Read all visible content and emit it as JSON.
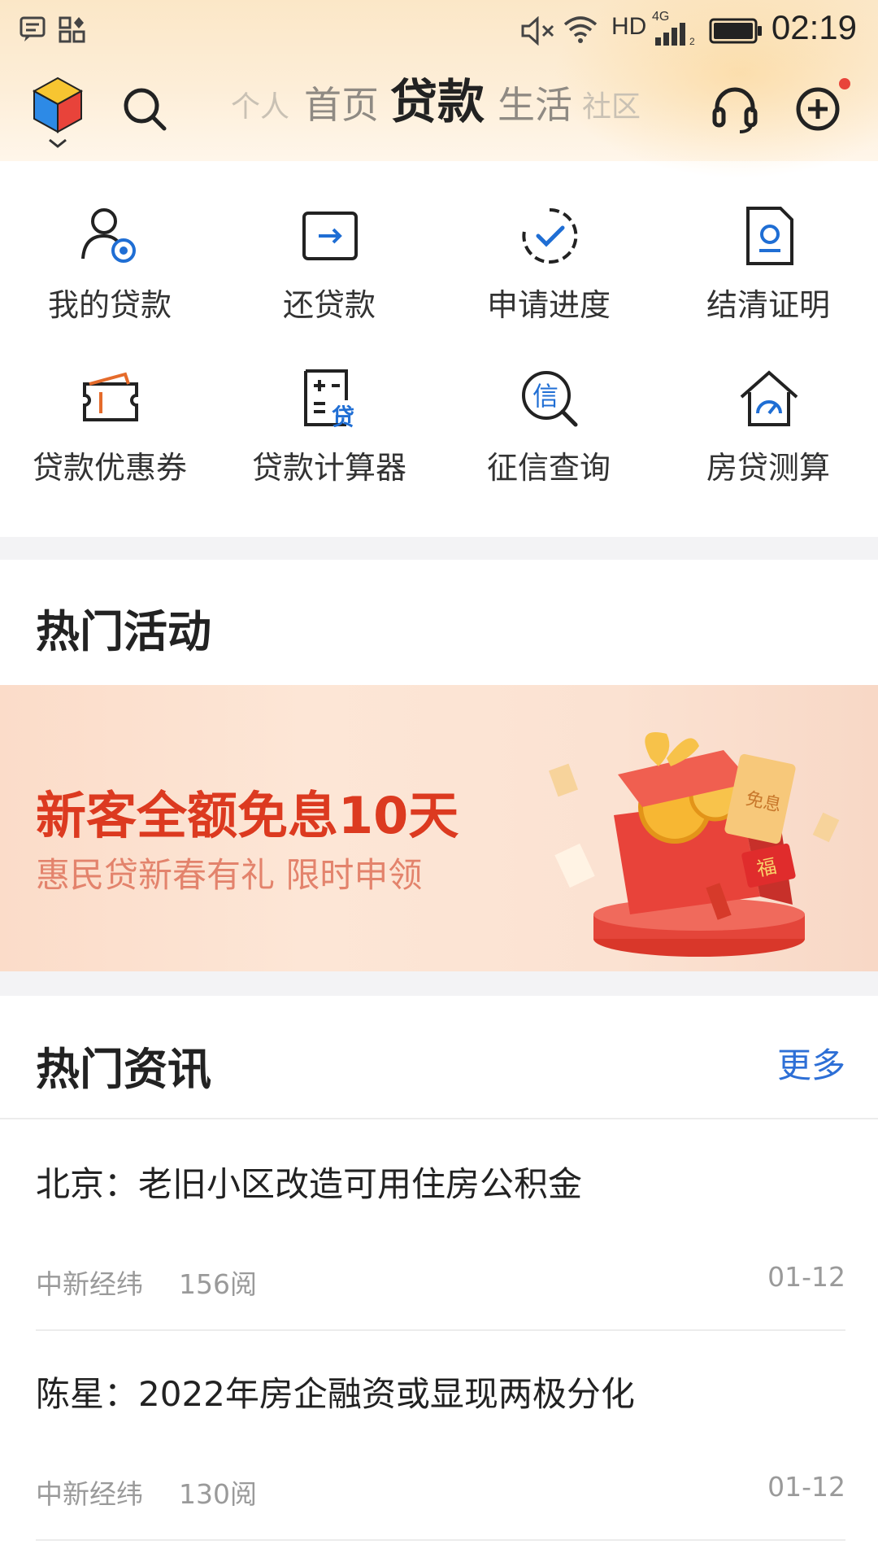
{
  "status_bar": {
    "network": "HD",
    "signal_label": "4G",
    "time": "02:19",
    "icons": [
      "message-icon",
      "apps-icon",
      "mute-icon",
      "wifi-icon",
      "signal-icon",
      "battery-icon"
    ]
  },
  "top_nav": {
    "tabs": [
      {
        "label": "个人",
        "active": false
      },
      {
        "label": "首页",
        "active": false
      },
      {
        "label": "贷款",
        "active": true
      },
      {
        "label": "生活",
        "active": false
      },
      {
        "label": "社区",
        "active": false
      }
    ],
    "right_icons": [
      "headset-icon",
      "add-icon"
    ]
  },
  "services": [
    {
      "label": "我的贷款",
      "icon": "user-loan-icon"
    },
    {
      "label": "还贷款",
      "icon": "repay-icon"
    },
    {
      "label": "申请进度",
      "icon": "progress-check-icon"
    },
    {
      "label": "结清证明",
      "icon": "certificate-icon"
    },
    {
      "label": "贷款优惠券",
      "icon": "coupon-icon"
    },
    {
      "label": "贷款计算器",
      "icon": "calculator-icon"
    },
    {
      "label": "征信查询",
      "icon": "credit-search-icon"
    },
    {
      "label": "房贷测算",
      "icon": "house-gauge-icon"
    }
  ],
  "activities": {
    "title": "热门活动",
    "banner": {
      "headline": "新客全额免息10天",
      "subline": "惠民贷新春有礼 限时申领",
      "gift_text_1": "免息",
      "gift_text_2": "福"
    }
  },
  "news": {
    "title": "热门资讯",
    "more_label": "更多",
    "items": [
      {
        "title": "北京：老旧小区改造可用住房公积金",
        "source": "中新经纬",
        "reads": "156阅",
        "date": "01-12"
      },
      {
        "title": "陈星：2022年房企融资或显现两极分化",
        "source": "中新经纬",
        "reads": "130阅",
        "date": "01-12"
      }
    ]
  },
  "colors": {
    "accent_blue": "#1f6ed4",
    "banner_red": "#dc3a20",
    "notification_dot": "#e8443a"
  }
}
